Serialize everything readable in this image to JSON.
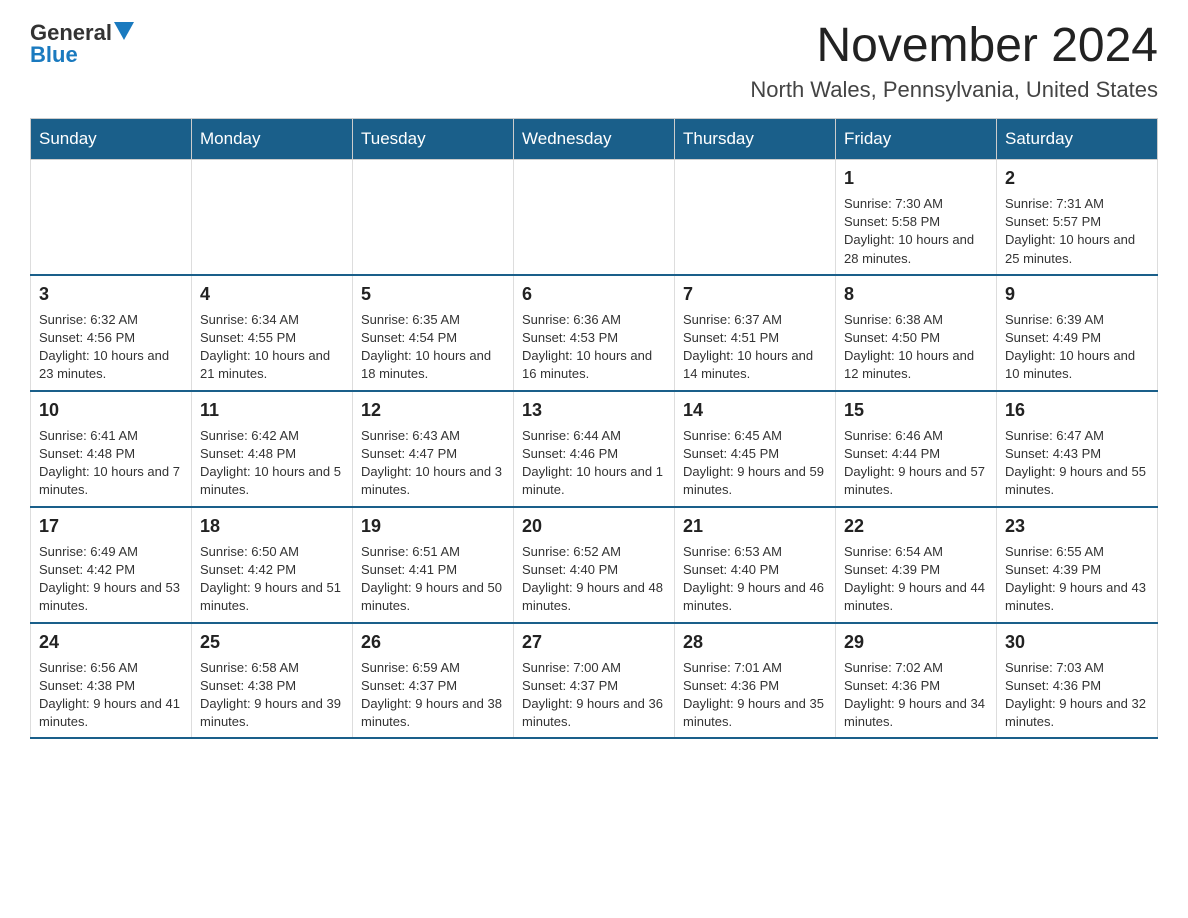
{
  "header": {
    "logo_general": "General",
    "logo_blue": "Blue",
    "month_title": "November 2024",
    "location": "North Wales, Pennsylvania, United States"
  },
  "weekdays": [
    "Sunday",
    "Monday",
    "Tuesday",
    "Wednesday",
    "Thursday",
    "Friday",
    "Saturday"
  ],
  "weeks": [
    [
      {
        "day": "",
        "info": ""
      },
      {
        "day": "",
        "info": ""
      },
      {
        "day": "",
        "info": ""
      },
      {
        "day": "",
        "info": ""
      },
      {
        "day": "",
        "info": ""
      },
      {
        "day": "1",
        "info": "Sunrise: 7:30 AM\nSunset: 5:58 PM\nDaylight: 10 hours and 28 minutes."
      },
      {
        "day": "2",
        "info": "Sunrise: 7:31 AM\nSunset: 5:57 PM\nDaylight: 10 hours and 25 minutes."
      }
    ],
    [
      {
        "day": "3",
        "info": "Sunrise: 6:32 AM\nSunset: 4:56 PM\nDaylight: 10 hours and 23 minutes."
      },
      {
        "day": "4",
        "info": "Sunrise: 6:34 AM\nSunset: 4:55 PM\nDaylight: 10 hours and 21 minutes."
      },
      {
        "day": "5",
        "info": "Sunrise: 6:35 AM\nSunset: 4:54 PM\nDaylight: 10 hours and 18 minutes."
      },
      {
        "day": "6",
        "info": "Sunrise: 6:36 AM\nSunset: 4:53 PM\nDaylight: 10 hours and 16 minutes."
      },
      {
        "day": "7",
        "info": "Sunrise: 6:37 AM\nSunset: 4:51 PM\nDaylight: 10 hours and 14 minutes."
      },
      {
        "day": "8",
        "info": "Sunrise: 6:38 AM\nSunset: 4:50 PM\nDaylight: 10 hours and 12 minutes."
      },
      {
        "day": "9",
        "info": "Sunrise: 6:39 AM\nSunset: 4:49 PM\nDaylight: 10 hours and 10 minutes."
      }
    ],
    [
      {
        "day": "10",
        "info": "Sunrise: 6:41 AM\nSunset: 4:48 PM\nDaylight: 10 hours and 7 minutes."
      },
      {
        "day": "11",
        "info": "Sunrise: 6:42 AM\nSunset: 4:48 PM\nDaylight: 10 hours and 5 minutes."
      },
      {
        "day": "12",
        "info": "Sunrise: 6:43 AM\nSunset: 4:47 PM\nDaylight: 10 hours and 3 minutes."
      },
      {
        "day": "13",
        "info": "Sunrise: 6:44 AM\nSunset: 4:46 PM\nDaylight: 10 hours and 1 minute."
      },
      {
        "day": "14",
        "info": "Sunrise: 6:45 AM\nSunset: 4:45 PM\nDaylight: 9 hours and 59 minutes."
      },
      {
        "day": "15",
        "info": "Sunrise: 6:46 AM\nSunset: 4:44 PM\nDaylight: 9 hours and 57 minutes."
      },
      {
        "day": "16",
        "info": "Sunrise: 6:47 AM\nSunset: 4:43 PM\nDaylight: 9 hours and 55 minutes."
      }
    ],
    [
      {
        "day": "17",
        "info": "Sunrise: 6:49 AM\nSunset: 4:42 PM\nDaylight: 9 hours and 53 minutes."
      },
      {
        "day": "18",
        "info": "Sunrise: 6:50 AM\nSunset: 4:42 PM\nDaylight: 9 hours and 51 minutes."
      },
      {
        "day": "19",
        "info": "Sunrise: 6:51 AM\nSunset: 4:41 PM\nDaylight: 9 hours and 50 minutes."
      },
      {
        "day": "20",
        "info": "Sunrise: 6:52 AM\nSunset: 4:40 PM\nDaylight: 9 hours and 48 minutes."
      },
      {
        "day": "21",
        "info": "Sunrise: 6:53 AM\nSunset: 4:40 PM\nDaylight: 9 hours and 46 minutes."
      },
      {
        "day": "22",
        "info": "Sunrise: 6:54 AM\nSunset: 4:39 PM\nDaylight: 9 hours and 44 minutes."
      },
      {
        "day": "23",
        "info": "Sunrise: 6:55 AM\nSunset: 4:39 PM\nDaylight: 9 hours and 43 minutes."
      }
    ],
    [
      {
        "day": "24",
        "info": "Sunrise: 6:56 AM\nSunset: 4:38 PM\nDaylight: 9 hours and 41 minutes."
      },
      {
        "day": "25",
        "info": "Sunrise: 6:58 AM\nSunset: 4:38 PM\nDaylight: 9 hours and 39 minutes."
      },
      {
        "day": "26",
        "info": "Sunrise: 6:59 AM\nSunset: 4:37 PM\nDaylight: 9 hours and 38 minutes."
      },
      {
        "day": "27",
        "info": "Sunrise: 7:00 AM\nSunset: 4:37 PM\nDaylight: 9 hours and 36 minutes."
      },
      {
        "day": "28",
        "info": "Sunrise: 7:01 AM\nSunset: 4:36 PM\nDaylight: 9 hours and 35 minutes."
      },
      {
        "day": "29",
        "info": "Sunrise: 7:02 AM\nSunset: 4:36 PM\nDaylight: 9 hours and 34 minutes."
      },
      {
        "day": "30",
        "info": "Sunrise: 7:03 AM\nSunset: 4:36 PM\nDaylight: 9 hours and 32 minutes."
      }
    ]
  ]
}
